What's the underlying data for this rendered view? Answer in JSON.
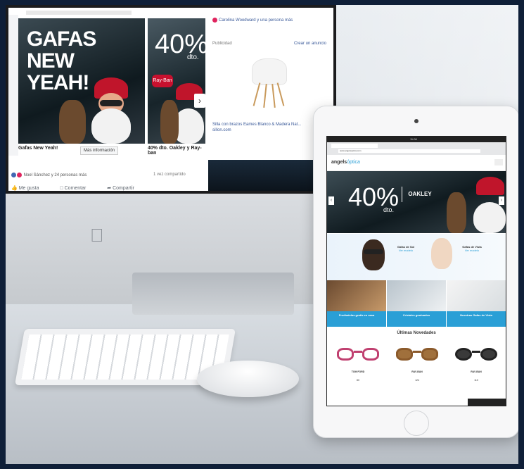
{
  "colors": {
    "facebook_blue": "#4267b2",
    "link_blue": "#385898",
    "site_accent": "#2a9fd6",
    "rayban_red": "#c8102e",
    "background": "#0f1f38"
  },
  "imac": {
    "facebook": {
      "card1": {
        "headline": "GAFAS NEW YEAH!",
        "caption": "Gafas New Yeah!",
        "button": "Más información"
      },
      "card2": {
        "percent": "40%",
        "dto": "dto.",
        "caption": "40% dto. Oakley y Ray-ban"
      },
      "reactions": "Noel Sánchez y 24 personas más",
      "shared": "1 vez compartido",
      "actions": [
        {
          "label": "Me gusta",
          "icon": "like-icon"
        },
        {
          "label": "Comentar",
          "icon": "comment-icon"
        },
        {
          "label": "Compartir",
          "icon": "share-icon"
        }
      ],
      "sidebar": {
        "header": "Carolina Woodward y una persona más",
        "publicidad": "Publicidad",
        "crear_anuncio": "Crear un anuncio",
        "ad_title": "Silla con brazos Eames Blanco & Madera Nat...",
        "ad_domain": "sillon.com"
      }
    }
  },
  "ipad": {
    "status_time": "11:06",
    "url": "www.angelsoptica.com",
    "logo_main": "angels",
    "logo_sub": "óptica",
    "hero": {
      "percent": "40%",
      "dto": "dto.",
      "brand": "OAKLEY"
    },
    "models": [
      {
        "title": "Gafas de Sol",
        "link": "Ver modelo"
      },
      {
        "title": "Gafas de Vista",
        "link": "Ver modelo"
      }
    ],
    "tiles": [
      "Pruébatelas gratis en casa",
      "Cristales graduados",
      "Nuestras Gafas de Vista"
    ],
    "novedades": "Últimas Novedades",
    "products": [
      {
        "name": "TOM FORD",
        "price": "80"
      },
      {
        "name": "RAY-BAN",
        "price": "124"
      },
      {
        "name": "RAY-BAN",
        "price": "110"
      }
    ]
  }
}
